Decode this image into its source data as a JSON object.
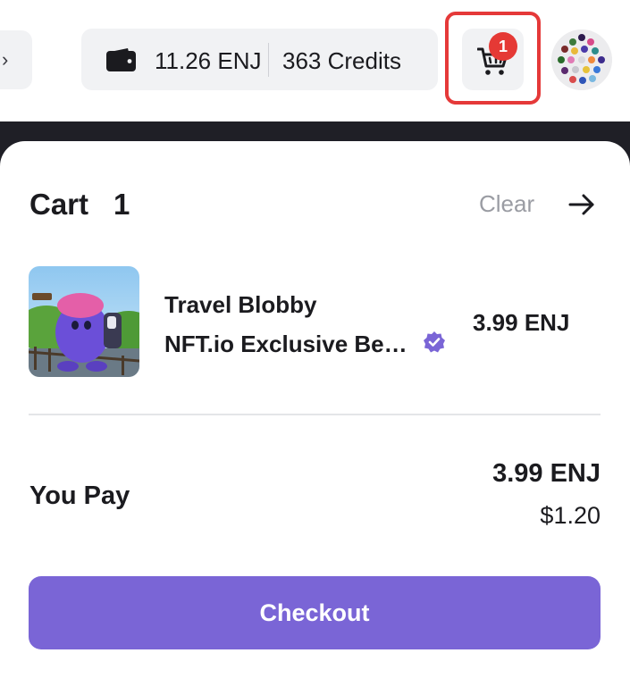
{
  "header": {
    "wallet_icon": "wallet-icon",
    "enj_balance": "11.26 ENJ",
    "credits": "363 Credits",
    "cart_icon": "cart-icon",
    "cart_badge_count": "1",
    "avatar_icon": "dotted-avatar"
  },
  "cart": {
    "title": "Cart",
    "count": "1",
    "clear_label": "Clear",
    "close_icon": "arrow-right-icon",
    "items": [
      {
        "name": "Travel Blobby",
        "collection": "NFT.io Exclusive Be…",
        "verified_icon": "verified-badge-icon",
        "price": "3.99 ENJ"
      }
    ],
    "you_pay_label": "You Pay",
    "total_enj": "3.99 ENJ",
    "total_usd": "$1.20",
    "checkout_label": "Checkout"
  },
  "colors": {
    "accent": "#7a65d6",
    "badge": "#e53935",
    "highlight": "#e53939",
    "dark_band": "#1f1f26",
    "muted": "#9a9ca3"
  }
}
